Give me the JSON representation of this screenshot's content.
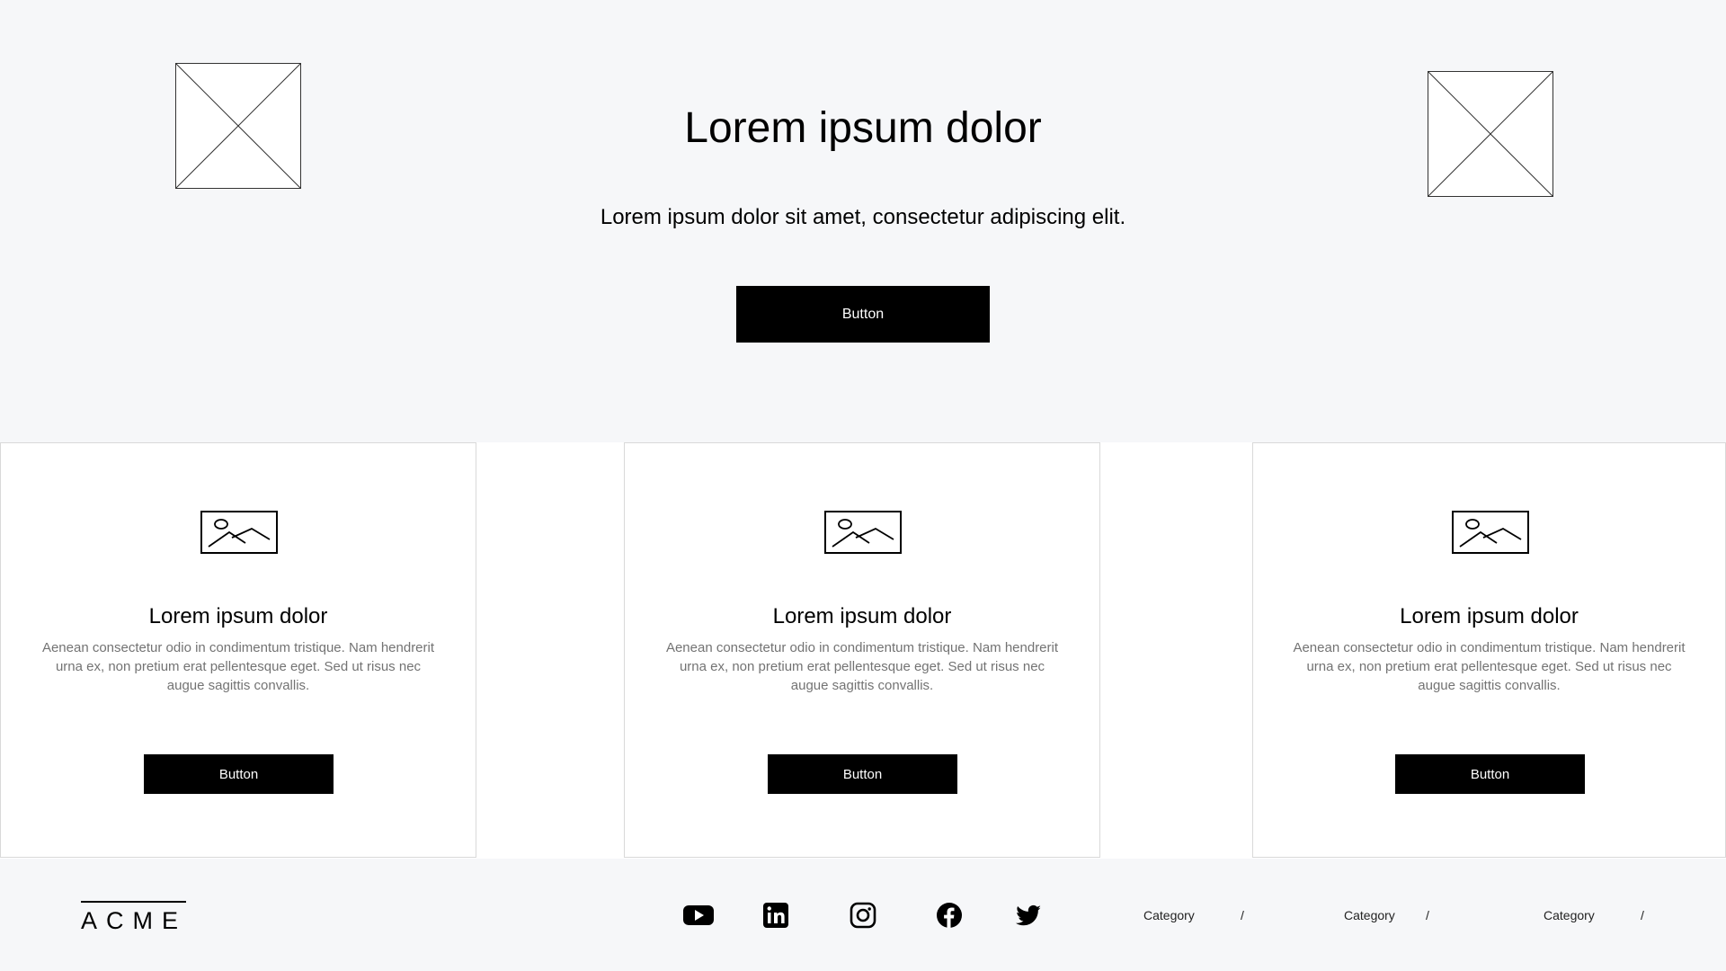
{
  "hero": {
    "title": "Lorem ipsum dolor",
    "subtitle": "Lorem ipsum dolor sit amet, consectetur adipiscing elit.",
    "button_label": "Button"
  },
  "cards": [
    {
      "title": "Lorem ipsum dolor",
      "text": "Aenean consectetur odio in condimentum tristique. Nam hendrerit urna ex, non pretium erat pellentesque eget. Sed ut risus nec augue sagittis convallis.",
      "button_label": "Button",
      "icon": "image-icon"
    },
    {
      "title": "Lorem ipsum dolor",
      "text": "Aenean consectetur odio in condimentum tristique. Nam hendrerit urna ex, non pretium erat pellentesque eget. Sed ut risus nec augue sagittis convallis.",
      "button_label": "Button",
      "icon": "image-icon"
    },
    {
      "title": "Lorem ipsum dolor",
      "text": "Aenean consectetur odio in condimentum tristique. Nam hendrerit urna ex, non pretium erat pellentesque eget. Sed ut risus nec augue sagittis convallis.",
      "button_label": "Button",
      "icon": "image-icon"
    }
  ],
  "footer": {
    "logo_text": "ACME",
    "social_icons": [
      "youtube-icon",
      "linkedin-icon",
      "instagram-icon",
      "facebook-icon",
      "twitter-icon"
    ],
    "categories": [
      "Category",
      "Category",
      "Category"
    ],
    "separator": "/"
  },
  "colors": {
    "background": "#f6f7f9",
    "card_background": "#ffffff",
    "button_background": "#000000",
    "button_text": "#ffffff",
    "body_text_muted": "#737373"
  }
}
